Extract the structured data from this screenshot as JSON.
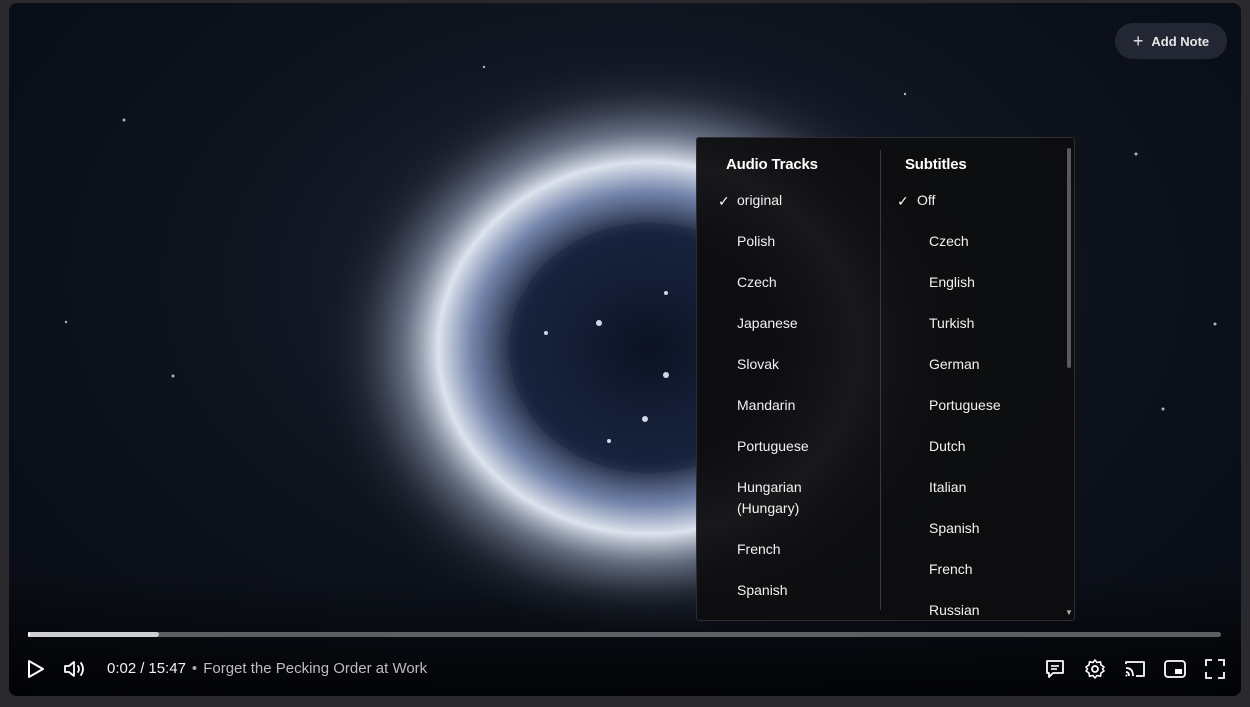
{
  "header": {
    "add_note_label": "Add Note"
  },
  "menu": {
    "audio": {
      "title": "Audio Tracks",
      "selected": "original",
      "items": [
        "original",
        "Polish",
        "Czech",
        "Japanese",
        "Slovak",
        "Mandarin",
        "Portuguese",
        "Hungarian (Hungary)",
        "French",
        "Spanish"
      ]
    },
    "subtitles": {
      "title": "Subtitles",
      "selected": "Off",
      "items": [
        "Off",
        "Czech",
        "English",
        "Turkish",
        "German",
        "Portuguese",
        "Dutch",
        "Italian",
        "Spanish",
        "French",
        "Russian"
      ]
    }
  },
  "player": {
    "current_time": "0:02",
    "separator": "/",
    "duration": "15:47",
    "bullet": "•",
    "video_title": "Forget the Pecking Order at Work",
    "progress_played_fraction": 0.002,
    "progress_buffered_fraction": 0.11
  },
  "icons": {
    "play": "play-icon",
    "volume": "volume-icon",
    "captions": "captions-icon",
    "settings": "gear-icon",
    "cast": "cast-icon",
    "miniplayer": "miniplayer-icon",
    "fullscreen": "fullscreen-icon",
    "plus": "plus-icon",
    "check": "check-icon"
  }
}
